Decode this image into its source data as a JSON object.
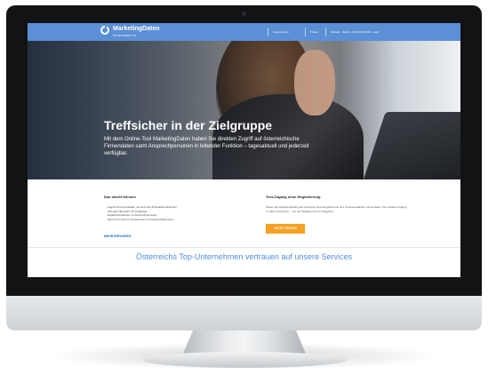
{
  "brand": {
    "name": "MarketingDaten",
    "tagline": "firmendaten.at"
  },
  "nav": [
    {
      "label": "Unternehmen"
    },
    {
      "label": "Preise"
    },
    {
      "label": "Kontakt · Telefon +43 (0)1 000 00 · Login"
    }
  ],
  "hero": {
    "title": "Treffsicher in der Zielgruppe",
    "text": "Mit dem Online-Tool MarketingDaten haben Sie direkten Zugriff auf österreichische Firmendaten samt Ansprechpersonen in leitender Funktion – tagesaktuell und jederzeit verfügbar."
  },
  "features": {
    "title": "Das steckt drinnen",
    "bullets": [
      "Zugriff auf Firmendaten mit mehr als 40 Selektionskriterien",
      "Schnelle Übersicht mit Trefferliste",
      "Detailinformationen zu Ansprechpersonen",
      "Export von Firmen mit Adressen und Ansprechpersonen"
    ],
    "link": "MEHR ERFAHREN"
  },
  "trial": {
    "title": "Test-Zugang ohne Registrierung",
    "text": "Testen Sie MarketingDaten jetzt kostenlos ohne Registrierung und mit ausgewählten Firmendaten. Sie erhalten Zugang zu allen Funktionen – von der Selektion bis zum Ergebnis.",
    "button": "JETZT TESTEN"
  },
  "trust": {
    "text": "Österreichs Top-Unternehmen vertrauen auf unsere Services"
  },
  "colors": {
    "topbar": "#5b8fd6",
    "accent_orange": "#f4a225",
    "link_blue": "#1f6fd1",
    "trust_blue": "#4f8fda"
  }
}
